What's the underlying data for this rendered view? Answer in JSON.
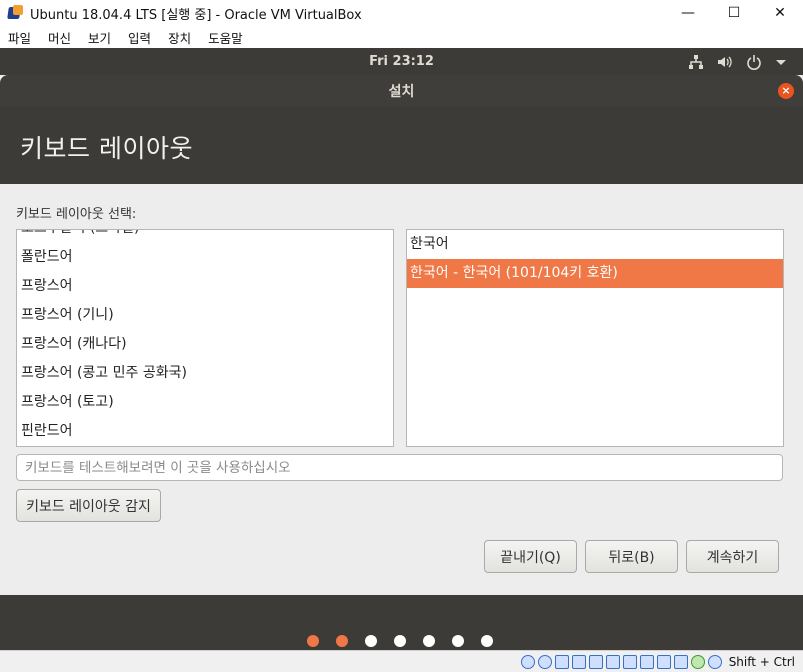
{
  "window": {
    "title": "Ubuntu 18.04.4 LTS [실행 중] - Oracle VM VirtualBox",
    "min_glyph": "—",
    "max_glyph": "☐",
    "close_glyph": "✕"
  },
  "menubar": {
    "items": [
      "파일",
      "머신",
      "보기",
      "입력",
      "장치",
      "도움말"
    ]
  },
  "panel": {
    "clock": "Fri 23:12",
    "icons": [
      "network-icon",
      "volume-icon",
      "power-icon",
      "chevron-down-icon"
    ]
  },
  "installer": {
    "window_title": "설치",
    "close_glyph": "×",
    "heading": "키보드 레이아웃",
    "prompt": "키보드 레이아웃 선택:",
    "layouts": [
      "포르투갈어 (브라질)",
      "폴란드어",
      "프랑스어",
      "프랑스어 (기니)",
      "프랑스어 (캐나다)",
      "프랑스어 (콩고 민주 공화국)",
      "프랑스어 (토고)",
      "핀란드어"
    ],
    "variants": [
      {
        "label": "한국어",
        "selected": false
      },
      {
        "label": "한국어 - 한국어 (101/104키 호환)",
        "selected": true
      }
    ],
    "test_placeholder": "키보드를 테스트해보려면 이 곳을 사용하십시오",
    "detect_label": "키보드 레이아웃 감지",
    "quit_label": "끝내기(Q)",
    "back_label": "뒤로(B)",
    "continue_label": "계속하기",
    "progress": {
      "total_steps": 7,
      "current_step": 2
    }
  },
  "colors": {
    "accent": "#f07746",
    "panel": "#3c3b37",
    "highlight": "#f5f31a"
  },
  "statusbar": {
    "host_key": "Shift + Ctrl"
  }
}
